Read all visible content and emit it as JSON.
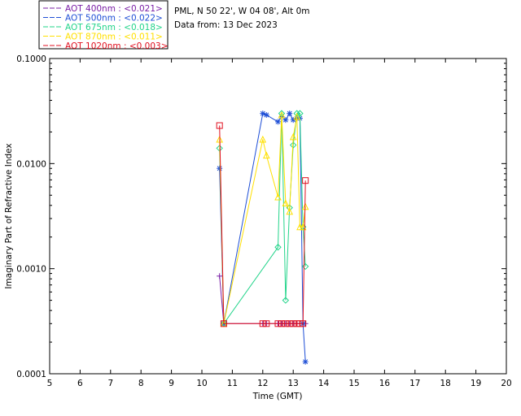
{
  "header": {
    "site": "PML, N 50 22', W 04 08', Alt 0m",
    "date": "Data from: 13 Dec 2023"
  },
  "chart_data": {
    "type": "line",
    "title": "",
    "xlabel": "Time (GMT)",
    "ylabel": "Imaginary Part of Refractive Index",
    "xlim": [
      5,
      20
    ],
    "ylim": [
      0.0001,
      0.1
    ],
    "yscale": "log",
    "x_ticks": [
      "5",
      "6",
      "7",
      "8",
      "9",
      "10",
      "11",
      "12",
      "13",
      "14",
      "15",
      "16",
      "17",
      "18",
      "19",
      "20"
    ],
    "y_ticks": [
      "0.0001",
      "0.0010",
      "0.0100",
      "0.1000"
    ],
    "grid": false,
    "legend_position": "top-left (outside plot)",
    "series": [
      {
        "name": "AOT  400nm : <0.021>",
        "color": "#7a1fa6",
        "marker": "plus",
        "x": [
          10.58,
          10.72,
          12.0,
          12.12,
          12.5,
          12.62,
          12.75,
          12.88,
          13.0,
          13.12,
          13.22,
          13.32,
          13.4
        ],
        "y": [
          0.00085,
          0.0003,
          0.0003,
          0.0003,
          0.0003,
          0.0003,
          0.0003,
          0.0003,
          0.0003,
          0.0003,
          0.0003,
          0.0003,
          0.0003
        ]
      },
      {
        "name": "AOT  500nm : <0.022>",
        "color": "#1f4fd6",
        "marker": "asterisk",
        "x": [
          10.58,
          10.72,
          12.0,
          12.12,
          12.5,
          12.62,
          12.75,
          12.88,
          13.0,
          13.12,
          13.22,
          13.32,
          13.4
        ],
        "y": [
          0.009,
          0.0003,
          0.03,
          0.029,
          0.025,
          0.028,
          0.026,
          0.03,
          0.026,
          0.027,
          0.027,
          0.0003,
          0.00013
        ]
      },
      {
        "name": "AOT  675nm : <0.018>",
        "color": "#22d48a",
        "marker": "diamond",
        "x": [
          10.58,
          10.72,
          12.5,
          12.62,
          12.75,
          12.88,
          13.0,
          13.12,
          13.22,
          13.32,
          13.4
        ],
        "y": [
          0.014,
          0.0003,
          0.0016,
          0.03,
          0.0005,
          0.0038,
          0.015,
          0.03,
          0.03,
          0.0025,
          0.00105
        ]
      },
      {
        "name": "AOT  870nm : <0.011>",
        "color": "#ffe000",
        "marker": "triangle",
        "x": [
          10.58,
          10.72,
          12.0,
          12.12,
          12.5,
          12.62,
          12.75,
          12.88,
          13.0,
          13.12,
          13.22,
          13.32,
          13.4
        ],
        "y": [
          0.017,
          0.0003,
          0.017,
          0.012,
          0.0048,
          0.029,
          0.0042,
          0.0035,
          0.018,
          0.028,
          0.0025,
          0.0025,
          0.0039
        ]
      },
      {
        "name": "AOT 1020nm : <0.003>",
        "color": "#e01020",
        "marker": "square",
        "x": [
          10.58,
          10.72,
          12.0,
          12.12,
          12.5,
          12.62,
          12.75,
          12.88,
          13.0,
          13.12,
          13.22,
          13.32,
          13.4
        ],
        "y": [
          0.023,
          0.0003,
          0.0003,
          0.0003,
          0.0003,
          0.0003,
          0.0003,
          0.0003,
          0.0003,
          0.0003,
          0.0003,
          0.0003,
          0.0069
        ]
      }
    ]
  }
}
